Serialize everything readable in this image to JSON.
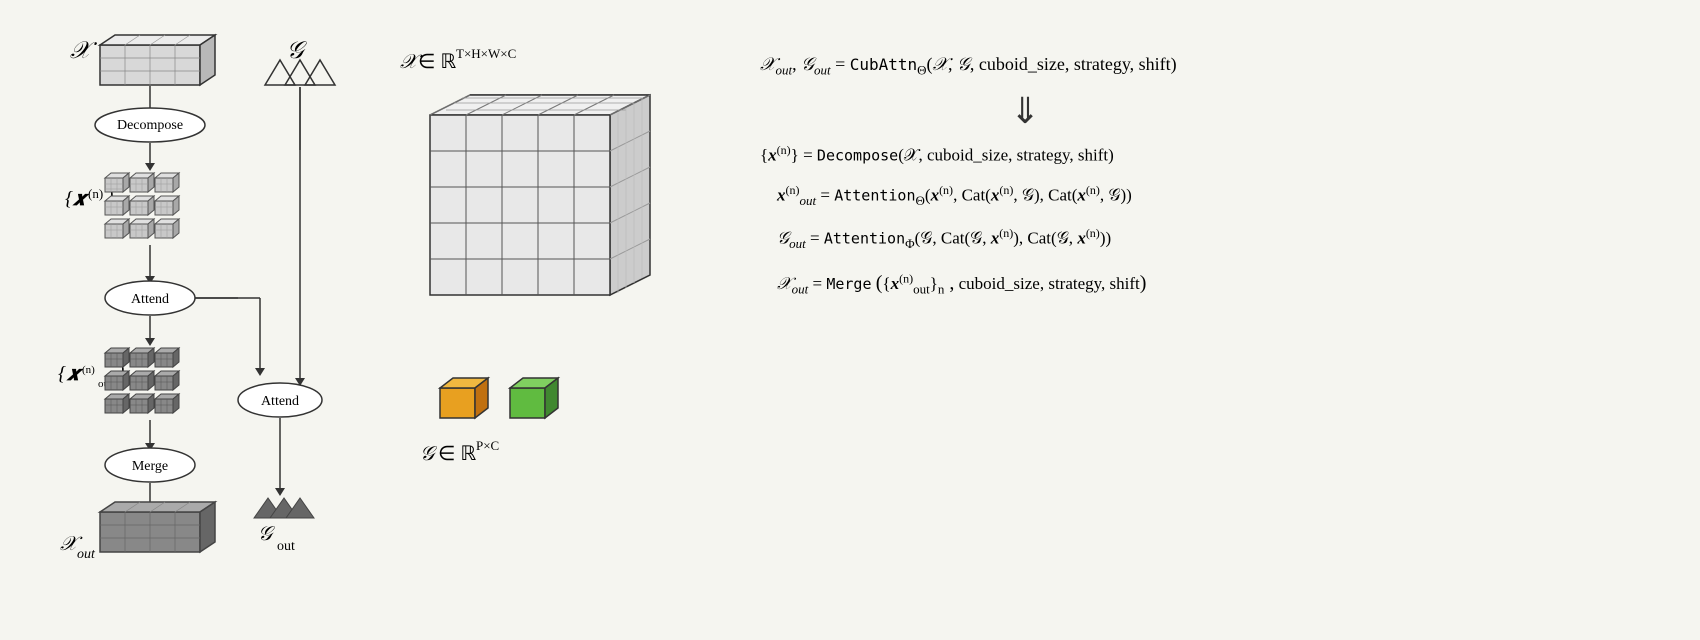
{
  "left": {
    "label_x": "𝒳",
    "label_x_out": "𝒳out",
    "label_xn": "{𝒙(n)}",
    "label_xn_out": "{𝒙out(n)}",
    "label_G": "𝒢",
    "label_G_out": "𝒢out",
    "decompose": "Decompose",
    "attend": "Attend",
    "attend2": "Attend",
    "merge": "Merge"
  },
  "middle": {
    "formula_x": "𝒳 ∈ ℝ",
    "formula_x_exp": "T×H×W×C",
    "formula_g": "𝒢 ∈ ℝ",
    "formula_g_exp": "P×C",
    "cube_orange_label": "orange cube",
    "cube_green_label": "green cube"
  },
  "right": {
    "eq1": "𝒳out, 𝒢out = CubAttn_Θ(𝒳, 𝒢, cuboid_size, strategy, shift)",
    "eq2": "{x(n)} = Decompose(𝒳, cuboid_size, strategy, shift)",
    "eq3_lhs": "x_out(n)",
    "eq3_rhs": "= Attention_Θ(x(n), Cat(x(n), 𝒢), Cat(x(n), 𝒢))",
    "eq4_lhs": "𝒢out",
    "eq4_rhs": "= Attention_Φ(𝒢, Cat(𝒢, x(n)), Cat(𝒢, x(n)))",
    "eq5_lhs": "𝒳out",
    "eq5_rhs": "= Merge({x_out(n)}_n, cuboid_size, strategy, shift)"
  }
}
